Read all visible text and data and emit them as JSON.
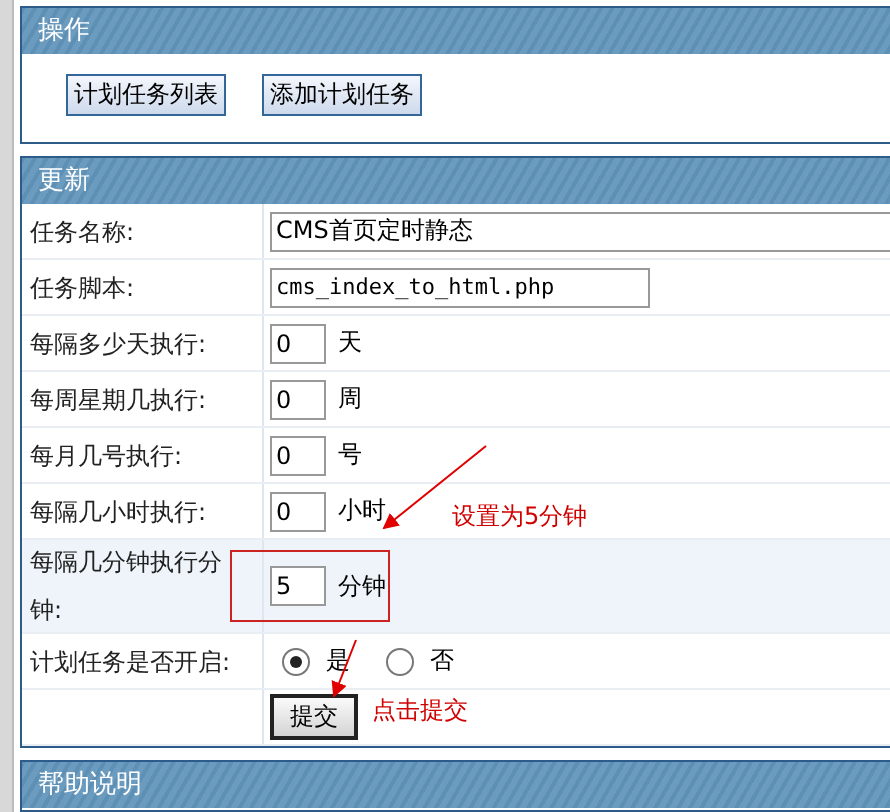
{
  "actions_panel": {
    "title": "操作",
    "buttons": [
      "计划任务列表",
      "添加计划任务"
    ]
  },
  "update_panel": {
    "title": "更新",
    "rows": [
      {
        "kind": "text",
        "label": "任务名称:",
        "value": "CMS首页定时静态",
        "highlighted": false
      },
      {
        "kind": "text",
        "label": "任务脚本:",
        "value": "cms_index_to_html.php",
        "highlighted": false
      },
      {
        "kind": "number",
        "label": "每隔多少天执行:",
        "value": "0",
        "unit": "天",
        "highlighted": false
      },
      {
        "kind": "number",
        "label": "每周星期几执行:",
        "value": "0",
        "unit": "周",
        "highlighted": false
      },
      {
        "kind": "number",
        "label": "每月几号执行:",
        "value": "0",
        "unit": "号",
        "highlighted": false
      },
      {
        "kind": "number",
        "label": "每隔几小时执行:",
        "value": "0",
        "unit": "小时",
        "highlighted": false
      },
      {
        "kind": "number",
        "label": "每隔几分钟执行分钟:",
        "value": "5",
        "unit": "分钟",
        "highlighted": true
      },
      {
        "kind": "radio",
        "label": "计划任务是否开启:",
        "options": [
          {
            "label": "是",
            "selected": true
          },
          {
            "label": "否",
            "selected": false
          }
        ],
        "highlighted": false
      },
      {
        "kind": "submit",
        "label": "",
        "button": "提交",
        "highlighted": false
      }
    ]
  },
  "help_panel": {
    "title": "帮助说明"
  },
  "annotations": [
    {
      "text": "设置为5分钟"
    },
    {
      "text": "点击提交"
    }
  ]
}
